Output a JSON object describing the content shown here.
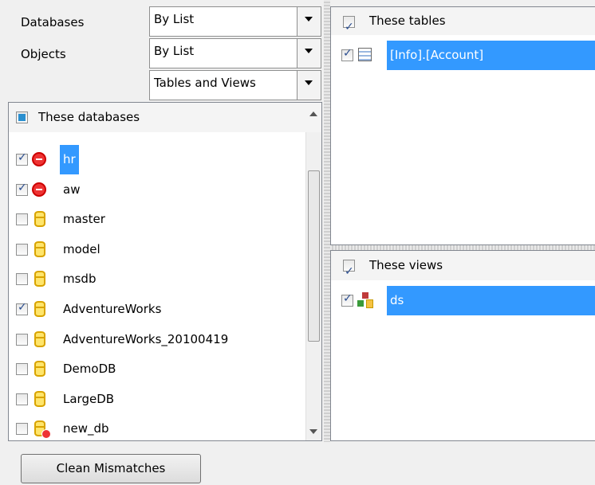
{
  "filters": {
    "databases_label": "Databases",
    "databases_value": "By List",
    "objects_label": "Objects",
    "objects_value": "By List",
    "object_type_value": "Tables and Views"
  },
  "db_panel": {
    "header": "These databases",
    "items": [
      {
        "label": "hr",
        "checked": true,
        "icon": "stop-icon",
        "selected": true
      },
      {
        "label": "aw",
        "checked": true,
        "icon": "stop-icon"
      },
      {
        "label": "master",
        "checked": false,
        "icon": "database-icon"
      },
      {
        "label": "model",
        "checked": false,
        "icon": "database-icon"
      },
      {
        "label": "msdb",
        "checked": false,
        "icon": "database-icon"
      },
      {
        "label": "AdventureWorks",
        "checked": true,
        "icon": "database-icon"
      },
      {
        "label": "AdventureWorks_20100419",
        "checked": false,
        "icon": "database-icon"
      },
      {
        "label": "DemoDB",
        "checked": false,
        "icon": "database-icon"
      },
      {
        "label": "LargeDB",
        "checked": false,
        "icon": "database-icon"
      },
      {
        "label": "new_db",
        "checked": false,
        "icon": "database-offline-icon"
      }
    ]
  },
  "tables_panel": {
    "header": "These tables",
    "items": [
      {
        "label": "[Info].[Account]",
        "checked": true,
        "icon": "table-icon"
      }
    ]
  },
  "views_panel": {
    "header": "These views",
    "items": [
      {
        "label": "ds",
        "checked": true,
        "icon": "view-icon"
      }
    ]
  },
  "actions": {
    "clean_mismatches": "Clean Mismatches"
  }
}
